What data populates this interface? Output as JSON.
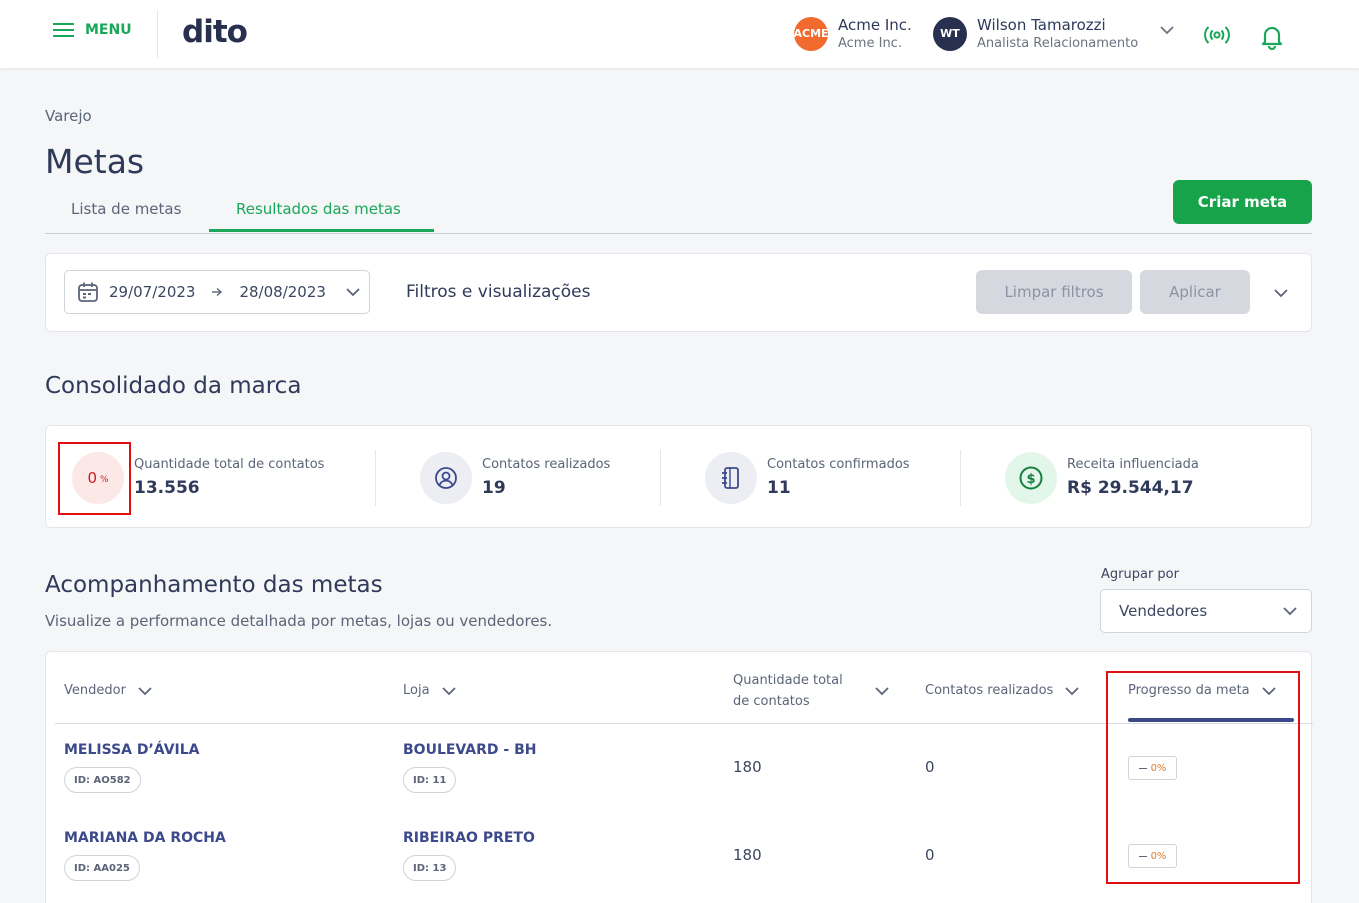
{
  "header": {
    "menu_label": "MENU",
    "logo_text": "dito",
    "company": {
      "avatar": "ACME",
      "name": "Acme Inc.",
      "sub": "Acme Inc.",
      "color": "#f26a2e"
    },
    "user": {
      "avatar": "WT",
      "name": "Wilson Tamarozzi",
      "role": "Analista Relacionamento",
      "color": "#27314f"
    }
  },
  "breadcrumb": "Varejo",
  "page_title": "Metas",
  "tabs": [
    {
      "label": "Lista de metas",
      "active": false
    },
    {
      "label": "Resultados das metas",
      "active": true
    }
  ],
  "create_button": "Criar meta",
  "filters": {
    "date_start": "29/07/2023",
    "date_end": "28/08/2023",
    "title": "Filtros e visualizações",
    "clear_label": "Limpar filtros",
    "apply_label": "Aplicar"
  },
  "consolidated": {
    "title": "Consolidado da marca",
    "progress_value": "0",
    "progress_unit": "%",
    "stats": [
      {
        "label": "Quantidade total de contatos",
        "value": "13.556",
        "icon": "progress-ring-icon"
      },
      {
        "label": "Contatos realizados",
        "value": "19",
        "icon": "user-circle-icon"
      },
      {
        "label": "Contatos confirmados",
        "value": "11",
        "icon": "notebook-icon"
      },
      {
        "label": "Receita influenciada",
        "value": "R$ 29.544,17",
        "icon": "dollar-icon"
      }
    ]
  },
  "tracking": {
    "title": "Acompanhamento das metas",
    "subtitle": "Visualize a performance detalhada por metas, lojas ou vendedores.",
    "group_by_label": "Agrupar por",
    "group_by_value": "Vendedores",
    "columns": {
      "seller": "Vendedor",
      "store": "Loja",
      "total_line1": "Quantidade total",
      "total_line2": "de contatos",
      "done": "Contatos realizados",
      "progress": "Progresso da meta"
    },
    "rows": [
      {
        "seller": "MELISSA D’ÁVILA",
        "seller_id": "ID: AO582",
        "store": "BOULEVARD - BH",
        "store_id": "ID: 11",
        "total": "180",
        "done": "0",
        "progress": "0%"
      },
      {
        "seller": "MARIANA DA ROCHA",
        "seller_id": "ID: AA025",
        "store": "RIBEIRAO PRETO",
        "store_id": "ID: 13",
        "total": "180",
        "done": "0",
        "progress": "0%"
      }
    ]
  },
  "colors": {
    "brand_green": "#16a34a",
    "accent_navy": "#3c4a8c",
    "highlight_red": "#e01010"
  }
}
